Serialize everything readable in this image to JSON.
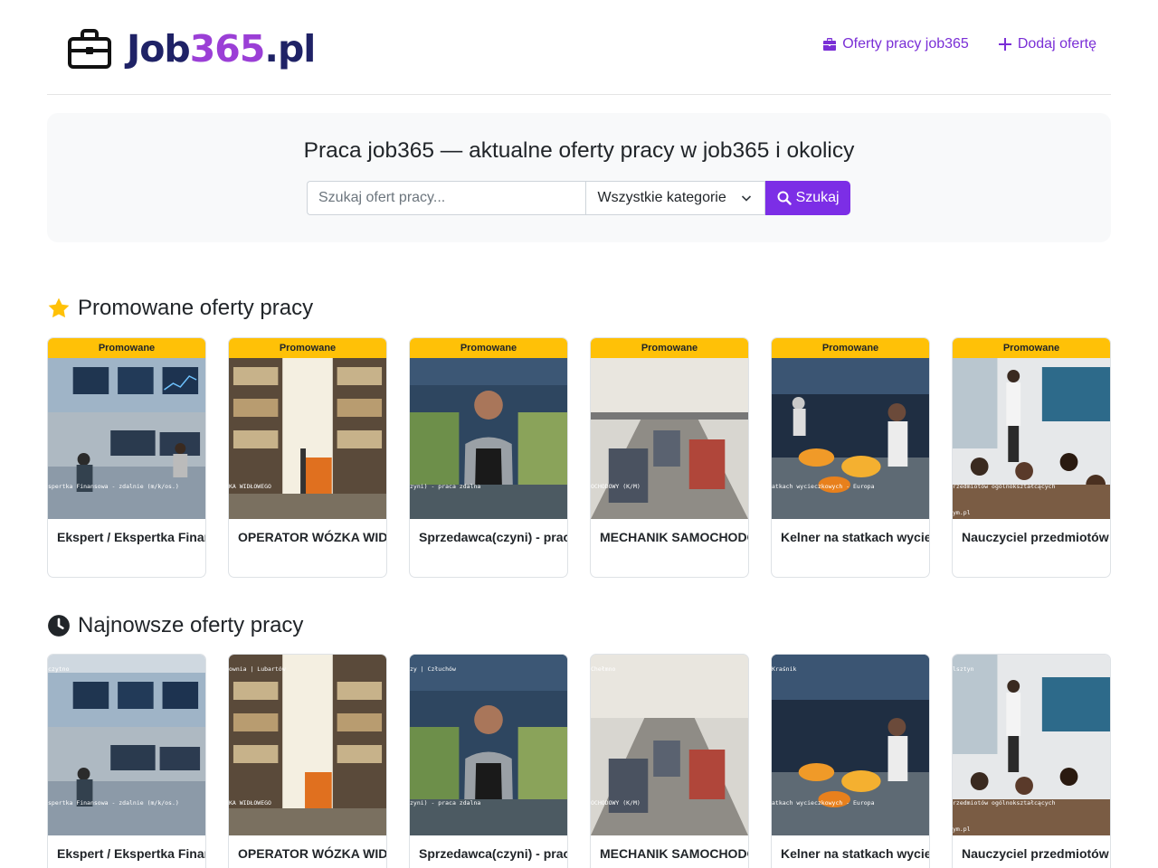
{
  "header": {
    "logo_prefix": "Job",
    "logo_number": "365",
    "logo_suffix": ".pl",
    "nav": [
      {
        "label": "Oferty pracy job365",
        "icon": "briefcase-icon"
      },
      {
        "label": "Dodaj ofertę",
        "icon": "plus-icon"
      }
    ]
  },
  "hero": {
    "title": "Praca job365 — aktualne oferty pracy w job365 i okolicy",
    "search_placeholder": "Szukaj ofert pracy...",
    "category_selected": "Wszystkie kategorie",
    "search_button": "Szukaj"
  },
  "promoted": {
    "heading": "Promowane oferty pracy",
    "icon": "star-icon",
    "badge": "Promowane",
    "cards": [
      {
        "title": "Ekspert / Ekspertka Finansowa - zdalnie",
        "image_caption": "spertka Finansowa - zdalnie (m/k/os.)",
        "image_footer": ""
      },
      {
        "title": "OPERATOR WÓZKA WIDŁOWEGO",
        "image_caption": "KA WIDŁOWEGO",
        "image_footer": ""
      },
      {
        "title": "Sprzedawca(czyni) - praca zdalna",
        "image_caption": "zyni) - praca zdalna",
        "image_footer": ""
      },
      {
        "title": "MECHANIK SAMOCHODOWY (K/M)",
        "image_caption": "OCHODOWY (K/M)",
        "image_footer": ""
      },
      {
        "title": "Kelner na statkach wycieczkowych - Europa",
        "image_caption": "atkach wycieczkowych - Europa",
        "image_footer": ""
      },
      {
        "title": "Nauczyciel przedmiotów ogólnokształcących",
        "image_caption": "rzedmiotów ogólnokształcących",
        "image_footer": "ym.pl"
      }
    ]
  },
  "newest": {
    "heading": "Najnowsze oferty pracy",
    "icon": "clock-icon",
    "cards": [
      {
        "title": "Ekspert / Ekspertka Finansowa - zdalnie",
        "image_top": "czytno",
        "image_caption": "spertka Finansowa - zdalnie (m/k/os.)",
        "image_footer": ""
      },
      {
        "title": "OPERATOR WÓZKA WIDŁOWEGO",
        "image_top": "ownia | Lubartów",
        "image_caption": "KA WIDŁOWEGO",
        "image_footer": ""
      },
      {
        "title": "Sprzedawca(czyni) - praca zdalna",
        "image_top": "zy | Człuchów",
        "image_caption": "zyni) - praca zdalna",
        "image_footer": ""
      },
      {
        "title": "MECHANIK SAMOCHODOWY (K/M)",
        "image_top": "Chełmno",
        "image_caption": "OCHODOWY (K/M)",
        "image_footer": ""
      },
      {
        "title": "Kelner na statkach wycieczkowych - Europa",
        "image_top": "Kraśnik",
        "image_caption": "atkach wycieczkowych - Europa",
        "image_footer": ""
      },
      {
        "title": "Nauczyciel przedmiotów ogólnokształcących",
        "image_top": "lsztyn",
        "image_caption": "rzedmiotów ogólnokształcących",
        "image_footer": "ym.pl"
      }
    ]
  },
  "colors": {
    "accent": "#7c2ee6",
    "badge": "#ffc107",
    "star": "#ffc107"
  }
}
